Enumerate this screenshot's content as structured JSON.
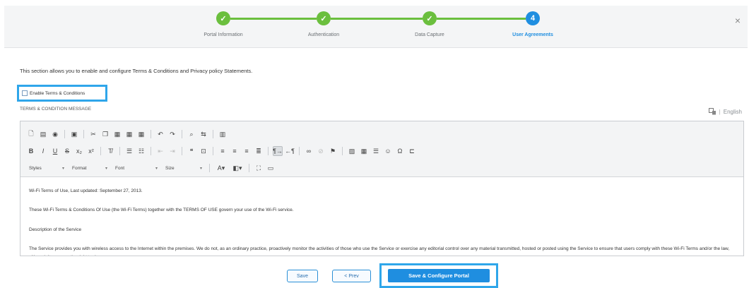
{
  "wizard": {
    "steps": [
      {
        "label": "Portal Information",
        "status": "done",
        "marker": "✓"
      },
      {
        "label": "Authentication",
        "status": "done",
        "marker": "✓"
      },
      {
        "label": "Data Capture",
        "status": "done",
        "marker": "✓"
      },
      {
        "label": "User Agreements",
        "status": "active",
        "marker": "4"
      }
    ],
    "close": "×",
    "colors": {
      "done": "#6bbf3e",
      "active": "#1f8ee0"
    }
  },
  "intro_text": "This section allows you to enable and configure Terms & Conditions and Privacy policy Statements.",
  "enable_terms_label": "Enable Terms & Conditions",
  "terms_heading": "TERMS & CONDITION MESSAGE",
  "language": {
    "icon": "translate-icon",
    "separator": "|",
    "value": "English"
  },
  "toolbar": {
    "styles": "Styles",
    "format": "Format",
    "font": "Font",
    "size": "Size"
  },
  "content": {
    "paragraphs": [
      "Wi-Fi Terms of Use, Last updated: September 27, 2013.",
      "These Wi-Fi Terms & Conditions Of Use (the Wi-Fi Terms) together with the TERMS OF USE govern your use of the Wi-Fi service.",
      "Description of the Service",
      "The Service provides you with wireless access to the Internet within the premises. We do not, as an ordinary practice, proactively monitor the activities of those who use the Service or exercise any editorial control over any material transmitted, hosted or posted using the Service to ensure that users comply with these Wi-Fi Terms and/or the law, although it reserves the right to do so."
    ]
  },
  "footer": {
    "save": "Save",
    "prev": "< Prev",
    "configure": "Save & Configure Portal"
  }
}
